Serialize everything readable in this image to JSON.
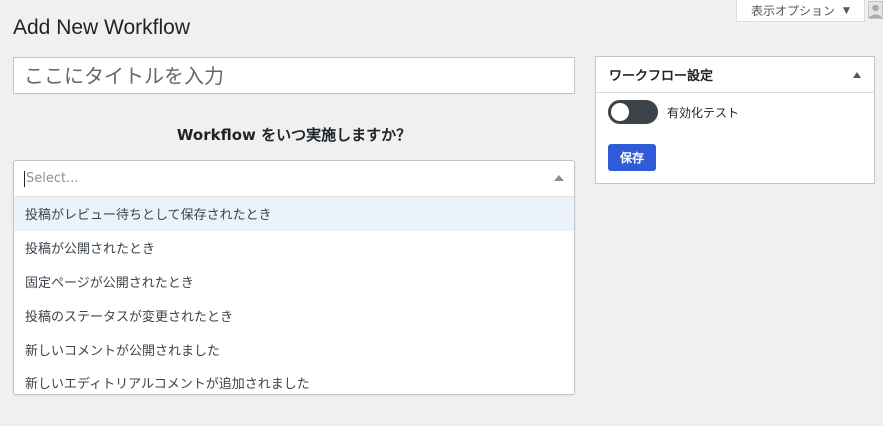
{
  "header": {
    "screen_options_label": "表示オプション",
    "page_title": "Add New Workflow"
  },
  "title_field": {
    "placeholder": "ここにタイトルを入力",
    "value": ""
  },
  "trigger": {
    "question": "Workflow をいつ実施しますか？",
    "select_placeholder": "Select...",
    "options": [
      {
        "label": "投稿がレビュー待ちとして保存されたとき"
      },
      {
        "label": "投稿が公開されたとき"
      },
      {
        "label": "固定ページが公開されたとき"
      },
      {
        "label": "投稿のステータスが変更されたとき"
      },
      {
        "label": "新しいコメントが公開されました"
      },
      {
        "label": "新しいエディトリアルコメントが追加されました"
      }
    ]
  },
  "settings_box": {
    "heading": "ワークフロー設定",
    "toggle_label": "有効化テスト",
    "toggle_on": false,
    "save_label": "保存"
  },
  "colors": {
    "background": "#f0f0f1",
    "primary_button": "#2f5bd8",
    "highlight": "#ebf2fa",
    "toggle_off": "#3c434a"
  }
}
